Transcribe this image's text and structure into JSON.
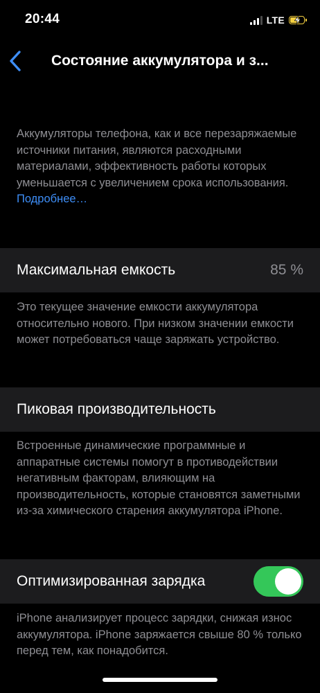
{
  "status_bar": {
    "time": "20:44",
    "network": "LTE",
    "signal_bars_active": 3,
    "signal_bars_total": 4,
    "battery_charging": true,
    "battery_color": "#f5d040"
  },
  "nav": {
    "back_icon": "chevron-left-icon",
    "title": "Состояние аккумулятора и з..."
  },
  "intro": {
    "text": "Аккумуляторы телефона, как и все перезаряжаемые источники питания, являются расходными материалами, эффективность работы которых уменьшается с увеличением срока использования. ",
    "link": "Подробнее…"
  },
  "max_capacity": {
    "label": "Максимальная емкость",
    "value": "85 %",
    "description": "Это текущее значение емкости аккумулятора относительно нового. При низком значении емкости может потребоваться чаще заряжать устройство."
  },
  "peak_performance": {
    "label": "Пиковая производительность",
    "description": "Встроенные динамические программные и аппаратные системы помогут в противодействии негативным факторам, влияющим на производительность, которые становятся заметными из-за химического старения аккумулятора iPhone."
  },
  "optimized_charging": {
    "label": "Оптимизированная зарядка",
    "enabled": true,
    "toggle_color": "#34c759",
    "description": "iPhone анализирует процесс зарядки, снижая износ аккумулятора. iPhone заряжается свыше 80 % только перед тем, как понадобится."
  }
}
